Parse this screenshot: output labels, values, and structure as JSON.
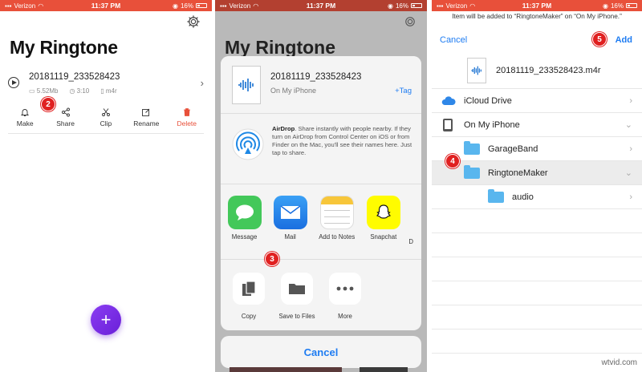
{
  "panel1": {
    "status": {
      "carrier": "Verizon",
      "time": "11:37 PM",
      "battery": "16%"
    },
    "title": "My Ringtone",
    "file": {
      "name": "20181119_233528423",
      "size": "5.52Mb",
      "duration": "3:10",
      "format": "m4r"
    },
    "actions": [
      {
        "label": "Make"
      },
      {
        "label": "Share"
      },
      {
        "label": "Clip"
      },
      {
        "label": "Rename"
      },
      {
        "label": "Delete"
      }
    ],
    "fab": "+",
    "badge": "2"
  },
  "panel2": {
    "status": {
      "carrier": "Verizon",
      "time": "11:37 PM",
      "battery": "16%"
    },
    "bg_title": "My Ringtone",
    "file": {
      "name": "20181119_233528423",
      "location": "On My iPhone",
      "tag": "+Tag"
    },
    "airdrop": {
      "title": "AirDrop",
      "text": ". Share instantly with people nearby. If they turn on AirDrop from Control Center on iOS or from Finder on the Mac, you'll see their names here. Just tap to share."
    },
    "apps": [
      {
        "label": "Message"
      },
      {
        "label": "Mail"
      },
      {
        "label": "Add to Notes"
      },
      {
        "label": "Snapchat"
      },
      {
        "label": "D"
      }
    ],
    "actions": [
      {
        "label": "Copy"
      },
      {
        "label": "Save to Files"
      },
      {
        "label": "More"
      }
    ],
    "cancel": "Cancel",
    "badge": "3"
  },
  "panel3": {
    "status": {
      "carrier": "Verizon",
      "time": "11:37 PM",
      "battery": "16%"
    },
    "info": "Item will be added to “RingtoneMaker” on “On My iPhone.”",
    "cancel": "Cancel",
    "add": "Add",
    "file_name": "20181119_233528423.m4r",
    "locations": [
      {
        "label": "iCloud Drive"
      },
      {
        "label": "On My iPhone"
      },
      {
        "label": "GarageBand"
      },
      {
        "label": "RingtoneMaker"
      },
      {
        "label": "audio"
      }
    ],
    "badge_add": "5",
    "badge_folder": "4",
    "watermark": "wtvid.com"
  },
  "colors": {
    "accent": "#e8503a",
    "ios_blue": "#1e7cf2",
    "folder": "#59b6ee",
    "fab": "#7a2fe6",
    "badge": "#e02020"
  }
}
